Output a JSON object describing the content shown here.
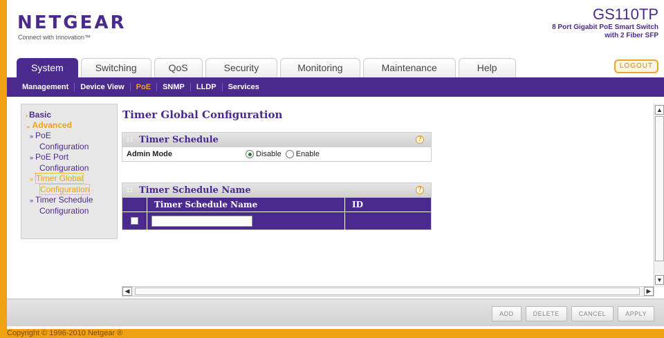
{
  "header": {
    "logo": "NETGEAR",
    "tagline": "Connect with Innovation™",
    "model": "GS110TP",
    "model_desc_line1": "8 Port Gigabit PoE Smart Switch",
    "model_desc_line2": "with 2 Fiber SFP",
    "logout_label": "LOGOUT"
  },
  "tabs": [
    {
      "label": "System",
      "active": true
    },
    {
      "label": "Switching"
    },
    {
      "label": "QoS"
    },
    {
      "label": "Security"
    },
    {
      "label": "Monitoring"
    },
    {
      "label": "Maintenance"
    },
    {
      "label": "Help"
    }
  ],
  "submenu": [
    {
      "label": "Management"
    },
    {
      "label": "Device View"
    },
    {
      "label": "PoE",
      "active": true
    },
    {
      "label": "SNMP"
    },
    {
      "label": "LLDP"
    },
    {
      "label": "Services"
    }
  ],
  "leftnav": {
    "basic": "Basic",
    "advanced": "Advanced",
    "items": [
      {
        "line1": "PoE",
        "line2": "Configuration"
      },
      {
        "line1": "PoE Port",
        "line2": "Configuration"
      },
      {
        "line1": "Timer Global",
        "line2": "Configuration",
        "active": true
      },
      {
        "line1": "Timer Schedule",
        "line2": "Configuration"
      }
    ]
  },
  "main": {
    "title": "Timer Global Configuration",
    "timer_schedule": {
      "heading": "Timer Schedule",
      "admin_mode_label": "Admin Mode",
      "options": [
        "Disable",
        "Enable"
      ],
      "selected": "Disable"
    },
    "timer_schedule_name": {
      "heading": "Timer Schedule Name",
      "columns": [
        "Timer Schedule Name",
        "ID"
      ],
      "input_value": ""
    }
  },
  "actions": [
    "ADD",
    "DELETE",
    "CANCEL",
    "APPLY"
  ],
  "footer": {
    "copyright": "Copyright © 1996-2010 Netgear ®"
  },
  "colors": {
    "brand": "#4b2a8e",
    "accent": "#f0a013"
  }
}
